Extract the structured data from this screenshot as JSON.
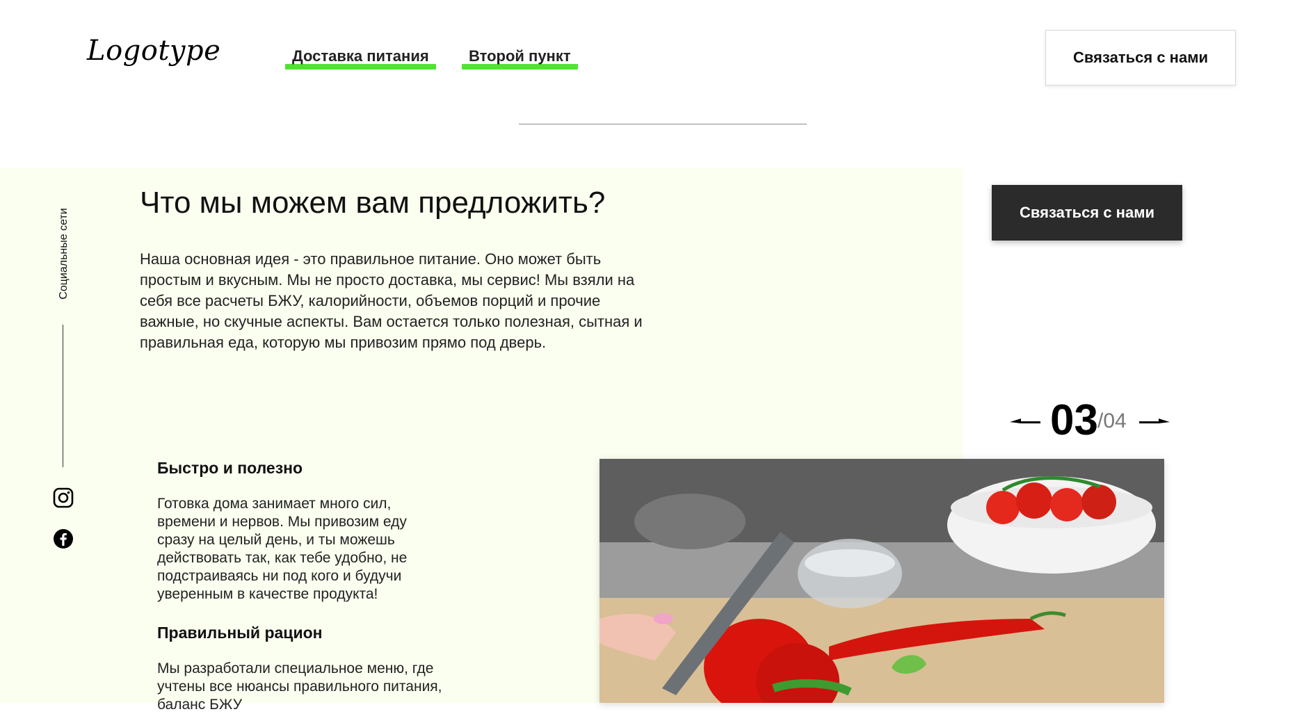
{
  "header": {
    "logo": "Logotype",
    "nav": [
      {
        "label": "Доставка питания"
      },
      {
        "label": "Второй пункт"
      }
    ],
    "contact_button": "Связаться с нами"
  },
  "sidebar": {
    "social_label": "Социальные сети",
    "icons": [
      "instagram-icon",
      "facebook-icon"
    ]
  },
  "section": {
    "title": "Что мы можем вам предложить?",
    "intro": "Наша основная идея - это правильное питание. Оно может быть простым и вкусным. Мы не просто доставка, мы сервис! Мы взяли на себя все расчеты БЖУ, калорийности, объемов порций и прочие важные, но скучные аспекты. Вам остается только полезная, сытная и правильная еда, которую мы привозим прямо под дверь.",
    "features": [
      {
        "title": "Быстро и полезно",
        "text": "Готовка дома занимает много сил, времени и нервов. Мы привозим еду сразу на целый день, и ты можешь действовать так, как тебе удобно, не подстраиваясь ни под кого и будучи уверенным в качестве продукта!"
      },
      {
        "title": "Правильный рацион",
        "text": "Мы разработали специальное меню, где учтены все нюансы правильного питания, баланс БЖУ"
      }
    ],
    "cta_button": "Связаться с нами"
  },
  "slider": {
    "current": "03",
    "total": "/04"
  },
  "colors": {
    "accent": "#52e332",
    "section_bg": "#fbfff0",
    "dark_button": "#2b2b2b"
  }
}
